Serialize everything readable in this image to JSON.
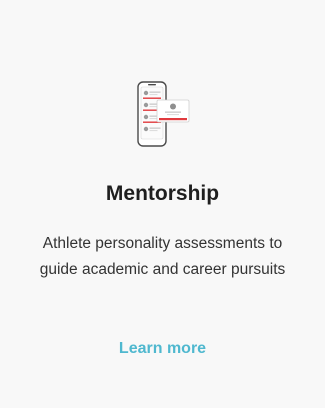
{
  "card": {
    "icon": "mentorship-app-illustration-icon",
    "title": "Mentorship",
    "description": "Athlete personality assessments to guide academic and career pursuits",
    "link_label": "Learn more"
  },
  "colors": {
    "background": "#f8f8f8",
    "title": "#1f1f1f",
    "text": "#333333",
    "link": "#4fb8cf",
    "accent": "#e03a3e"
  }
}
